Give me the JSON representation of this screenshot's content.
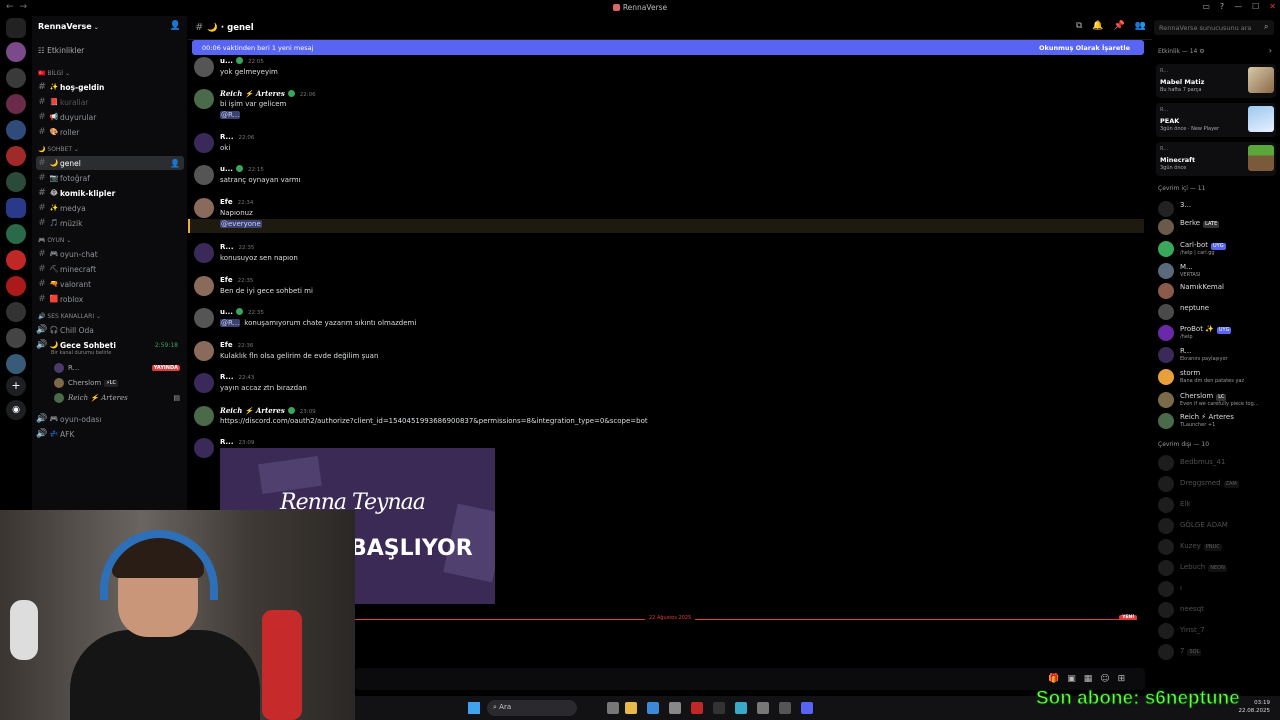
{
  "window": {
    "title": "RennaVerse"
  },
  "sidebar": {
    "server_name": "RennaVerse",
    "events_label": "Etkinlikler",
    "categories": {
      "info": "BİLGİ",
      "chat": "SOHBET",
      "game": "OYUN",
      "voice": "SES KANALLARI"
    },
    "channels": [
      {
        "label": "hoş-geldin",
        "emoji": "✨"
      },
      {
        "label": "kurallar",
        "emoji": "📕"
      },
      {
        "label": "duyurular",
        "emoji": "📢"
      },
      {
        "label": "roller",
        "emoji": "🎨"
      },
      {
        "label": "genel",
        "emoji": "🌙"
      },
      {
        "label": "fotoğraf",
        "emoji": "📷"
      },
      {
        "label": "komik-klipler",
        "emoji": "😂"
      },
      {
        "label": "medya",
        "emoji": "✨"
      },
      {
        "label": "müzik",
        "emoji": "🎵"
      },
      {
        "label": "oyun-chat",
        "emoji": "🎮"
      },
      {
        "label": "minecraft",
        "emoji": "⛏"
      },
      {
        "label": "valorant",
        "emoji": "🔫"
      },
      {
        "label": "roblox",
        "emoji": "🟥"
      }
    ],
    "voice": {
      "chill": "Chill Oda",
      "gece": "Gece Sohbeti",
      "gece_timer": "2:59:18",
      "gece_status": "Bir kanal durumu belirle",
      "live_badge": "YAYINDA",
      "users": [
        "R...",
        "Cherslom",
        "Reich ⚡ Arteres"
      ],
      "oyun_odasi": "oyun-odası",
      "afk": "AFK"
    }
  },
  "topbar": {
    "channel": "genel",
    "search_placeholder": "RennaVerse sunucusunu ara"
  },
  "newbar": {
    "text": "00:06 vaktinden beri 1 yeni mesaj",
    "mark": "Okunmuş Olarak İşaretle"
  },
  "messages": [
    {
      "author": "u...",
      "time": "22:05",
      "text": "yok gelmeyeyim"
    },
    {
      "author": "Reich ⚡ Arteres",
      "time": "22:06",
      "text": "bi işim var gelicem",
      "mention": "@R..."
    },
    {
      "author": "R...",
      "time": "22:06",
      "text": "oki"
    },
    {
      "author": "u...",
      "time": "22:15",
      "text": "satranç oynayan varmı"
    },
    {
      "author": "Efe",
      "time": "22:34",
      "text": "Napıonuz",
      "mention": "@everyone"
    },
    {
      "author": "R...",
      "time": "22:35",
      "text": "konusuyoz sen napıon"
    },
    {
      "author": "Efe",
      "time": "22:35",
      "text": "Ben de iyi gece sohbeti mi"
    },
    {
      "author": "u...",
      "time": "22:35",
      "mention": "@R...",
      "text": "konuşamıyorum chate yazarım sıkıntı olmazdemi"
    },
    {
      "author": "Efe",
      "time": "22:36",
      "text": "Kulaklık fln olsa gelirim de evde değilim şuan"
    },
    {
      "author": "R...",
      "time": "22:43",
      "text": "yayın accaz ztn bırazdan"
    },
    {
      "author": "Reich ⚡ Arteres",
      "time": "23:09",
      "link": "https://discord.com/oauth2/authorize?client_id=1540451993686900837&permissions=8&integration_type=0&scope=bot"
    },
    {
      "author": "R...",
      "time": "23:09"
    }
  ],
  "embed": {
    "line1": "Renna Teynaa",
    "line2": "BAŞLIYOR"
  },
  "divider": {
    "date": "22 Ağustos 2025",
    "new": "YENİ"
  },
  "activity": {
    "header": "Etkinlik — 14",
    "cards": [
      {
        "who": "R...",
        "name": "Mabel Matiz",
        "sub": "Bu hafta 7 parça"
      },
      {
        "who": "R...",
        "name": "PEAK",
        "sub": "3gün önce · New Player"
      },
      {
        "who": "R...",
        "name": "Minecraft",
        "sub": "3gün önce"
      }
    ]
  },
  "members": {
    "online_header": "Çevrim içi — 11",
    "offline_header": "Çevrim dışı — 10",
    "online": [
      {
        "name": "3...",
        "status": ""
      },
      {
        "name": "Berke",
        "status": "",
        "tag": "LATE"
      },
      {
        "name": "Carl-bot",
        "status": "/help | carl.gg",
        "tag": "UYG"
      },
      {
        "name": "M...",
        "status": "VERTASI"
      },
      {
        "name": "NamıkKemal",
        "status": ""
      },
      {
        "name": "neptune",
        "status": ""
      },
      {
        "name": "ProBot ✨",
        "status": "/help",
        "tag": "UYG"
      },
      {
        "name": "R...",
        "status": "Ekranını paylaşıyor"
      },
      {
        "name": "storm",
        "status": "Bana dm den patates yaz"
      },
      {
        "name": "Cherslom",
        "status": "Even if we carefully piece tog...",
        "tag": "LC"
      },
      {
        "name": "Reich ⚡ Arteres",
        "status": "TLauncher +1"
      }
    ],
    "offline": [
      {
        "name": "Bedbmus_41"
      },
      {
        "name": "Dreggsmed",
        "tag": "ZAM"
      },
      {
        "name": "Elk"
      },
      {
        "name": "GÖLGE ADAM"
      },
      {
        "name": "Kuzey",
        "tag": "PNUC"
      },
      {
        "name": "Lebuch",
        "tag": "NEON"
      },
      {
        "name": "ı"
      },
      {
        "name": "neesqt"
      },
      {
        "name": "Yinst_7"
      },
      {
        "name": "7",
        "tag": "SQL"
      }
    ]
  },
  "taskbar": {
    "search": "Ara",
    "time": "03:19",
    "date": "22.08.2025"
  },
  "overlay": {
    "last_sub": "Son abone: s6neptune"
  },
  "colors": {
    "accent": "#5865f2",
    "mention_bg": "#3c4270",
    "link": "#00a8fc",
    "live": "#e23b3b",
    "overlay_text": "#62ff3e"
  }
}
